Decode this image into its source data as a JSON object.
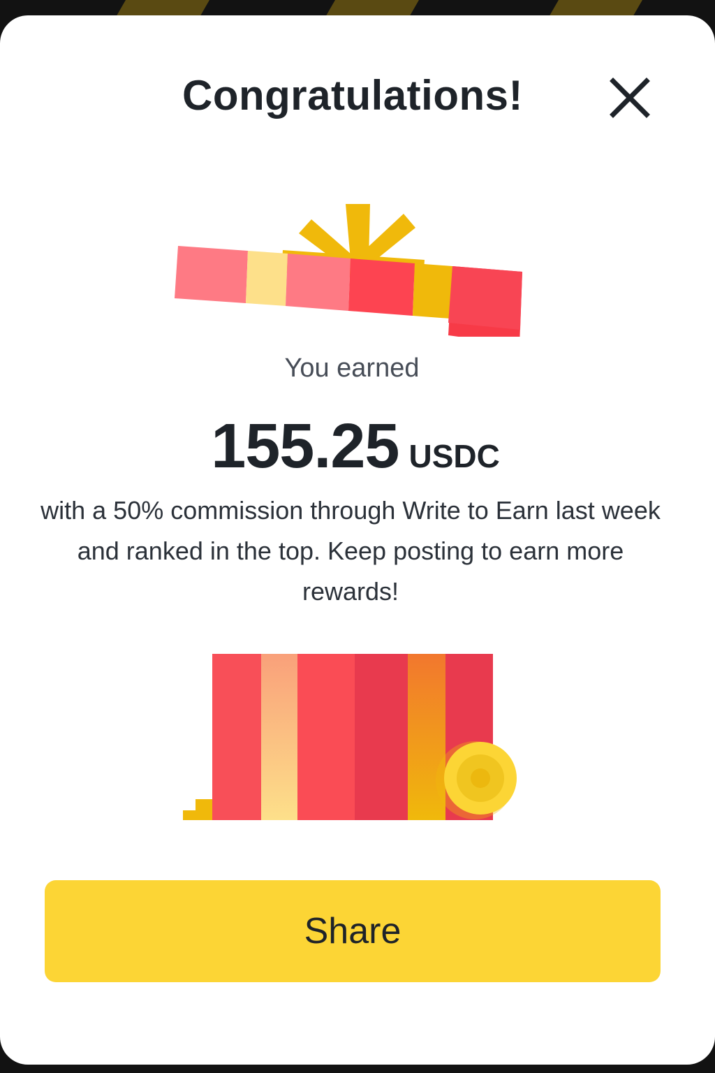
{
  "modal": {
    "title": "Congratulations!",
    "close_icon": "close-icon",
    "earned_label": "You earned",
    "amount": "155.25",
    "unit": "USDC",
    "description": "with a 50% commission through Write to Earn last week and ranked in the top. Keep posting to earn more rewards!",
    "share_label": "Share"
  },
  "colors": {
    "accent": "#fcd535",
    "text_primary": "#1e2329",
    "gift_red": "#f84960",
    "gift_yellow": "#f0b90b"
  }
}
